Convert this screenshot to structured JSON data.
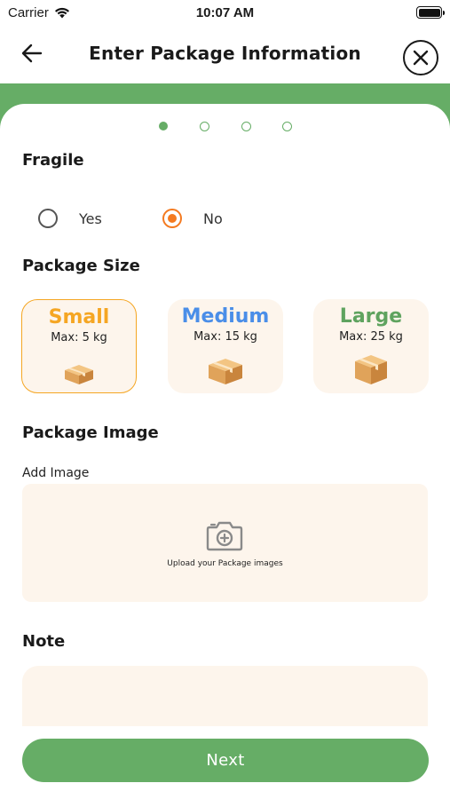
{
  "status_bar": {
    "carrier": "Carrier",
    "time": "10:07 AM"
  },
  "header": {
    "title": "Enter Package Information"
  },
  "stepper": {
    "total_steps": 4,
    "current_step": 1
  },
  "fragile": {
    "title": "Fragile",
    "options": [
      {
        "label": "Yes",
        "selected": false
      },
      {
        "label": "No",
        "selected": true
      }
    ]
  },
  "package_size": {
    "title": "Package Size",
    "options": [
      {
        "name": "Small",
        "max": "Max: 5 kg",
        "color": "#f5a623",
        "selected": true
      },
      {
        "name": "Medium",
        "max": "Max: 15 kg",
        "color": "#4a8ee8",
        "selected": false
      },
      {
        "name": "Large",
        "max": "Max: 25 kg",
        "color": "#5fa35f",
        "selected": false
      }
    ]
  },
  "package_image": {
    "title": "Package Image",
    "add_label": "Add Image",
    "upload_text": "Upload your Package images",
    "icon": "camera-add-icon"
  },
  "note": {
    "title": "Note",
    "value": ""
  },
  "next_button": {
    "label": "Next"
  },
  "colors": {
    "primary": "#66ad66",
    "accent": "#f47a20",
    "card_bg": "#fdf5ec"
  }
}
